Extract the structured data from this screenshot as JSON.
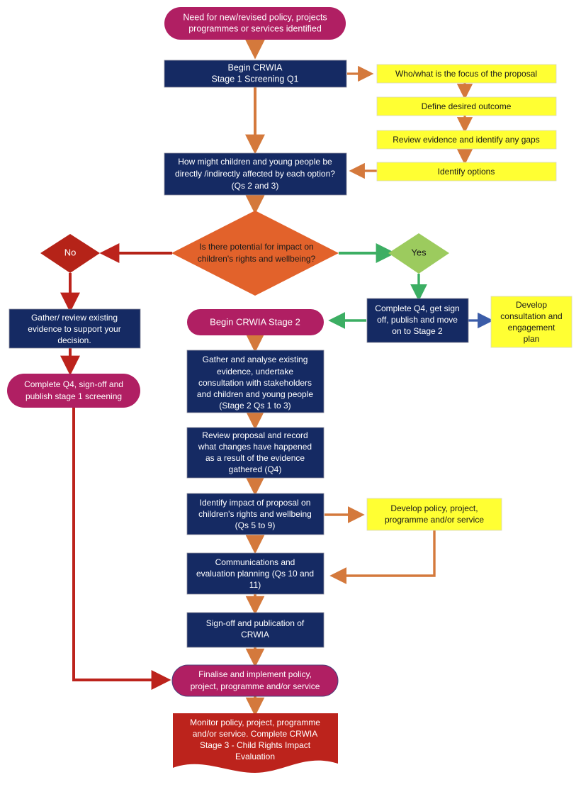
{
  "diagram": {
    "title": "CRWIA process flowchart",
    "palette": {
      "magenta": "#b01f63",
      "navy": "#152a63",
      "yellow": "#ffff33",
      "orange_fill": "#e2622b",
      "orange_arrow": "#d4793c",
      "dark_red": "#b52318",
      "red_fill": "#bc231c",
      "red_arrow": "#bc231c",
      "green_fill": "#9ccb5e",
      "green_arrow": "#3cae63",
      "blue_arrow": "#3b5ca8",
      "text_light": "#ffffff",
      "text_dark": "#1a1a1a"
    },
    "nodes": [
      {
        "id": "need",
        "shape": "rounded-pill",
        "color": "magenta",
        "lines": [
          "Need for  new/revised policy, projects",
          "programmes or services identified"
        ]
      },
      {
        "id": "begin-stage1",
        "shape": "rectangle",
        "color": "navy",
        "lines": [
          "Begin CRWIA",
          "Stage 1 Screening Q1"
        ]
      },
      {
        "id": "focus-of-proposal",
        "shape": "rectangle",
        "color": "yellow",
        "lines": [
          "Who/what is the focus of the proposal"
        ]
      },
      {
        "id": "define-outcome",
        "shape": "rectangle",
        "color": "yellow",
        "lines": [
          "Define desired outcome"
        ]
      },
      {
        "id": "review-evidence-gaps",
        "shape": "rectangle",
        "color": "yellow",
        "lines": [
          "Review evidence and identify any gaps"
        ]
      },
      {
        "id": "identify-options",
        "shape": "rectangle",
        "color": "yellow",
        "lines": [
          "Identify options"
        ]
      },
      {
        "id": "how-might-affected",
        "shape": "rectangle",
        "color": "navy",
        "lines": [
          "How might children and young people be",
          "directly /indirectly affected by each option?",
          "(Qs 2 and 3)"
        ]
      },
      {
        "id": "decision-potential-impact",
        "shape": "diamond",
        "color": "orange_fill",
        "lines": [
          "Is there potential for impact on",
          "children's rights and wellbeing?"
        ]
      },
      {
        "id": "decision-no",
        "shape": "diamond",
        "color": "dark_red",
        "lines": [
          "No"
        ]
      },
      {
        "id": "decision-yes",
        "shape": "diamond",
        "color": "green_fill",
        "lines": [
          "Yes"
        ]
      },
      {
        "id": "gather-review-existing",
        "shape": "rectangle",
        "color": "navy",
        "lines": [
          "Gather/ review existing",
          "evidence to support your",
          "decision."
        ]
      },
      {
        "id": "complete-q4-stage1",
        "shape": "rounded-pill",
        "color": "magenta",
        "lines": [
          "Complete Q4, sign-off and",
          "publish stage 1 screening"
        ]
      },
      {
        "id": "complete-q4-move-stage2",
        "shape": "rectangle",
        "color": "navy",
        "lines": [
          "Complete Q4, get sign",
          "off, publish and move",
          "on to Stage 2"
        ]
      },
      {
        "id": "develop-consultation-plan",
        "shape": "rectangle",
        "color": "yellow",
        "lines": [
          "Develop",
          "consultation and",
          "engagement",
          "plan"
        ]
      },
      {
        "id": "begin-stage2",
        "shape": "rounded-pill",
        "color": "magenta",
        "lines": [
          "Begin CRWIA Stage 2"
        ]
      },
      {
        "id": "gather-analyse",
        "shape": "rectangle",
        "color": "navy",
        "lines": [
          "Gather and analyse existing",
          "evidence, undertake",
          "consultation with stakeholders",
          "and children and young people",
          "(Stage 2 Qs 1 to 3)"
        ]
      },
      {
        "id": "review-proposal-record",
        "shape": "rectangle",
        "color": "navy",
        "lines": [
          "Review proposal and record",
          "what changes have happened",
          "as a result of the evidence",
          "gathered (Q4)"
        ]
      },
      {
        "id": "identify-impact",
        "shape": "rectangle",
        "color": "navy",
        "lines": [
          "Identify impact of proposal on",
          "children's rights and wellbeing",
          "(Qs 5 to 9)"
        ]
      },
      {
        "id": "develop-policy",
        "shape": "rectangle",
        "color": "yellow",
        "lines": [
          "Develop policy, project,",
          "programme and/or service"
        ]
      },
      {
        "id": "communications-evaluation",
        "shape": "rectangle",
        "color": "navy",
        "lines": [
          "Communications and",
          "evaluation planning (Qs 10 and",
          "11)"
        ]
      },
      {
        "id": "sign-off-publication",
        "shape": "rectangle",
        "color": "navy",
        "lines": [
          "Sign-off and publication of",
          "CRWIA"
        ]
      },
      {
        "id": "finalise-implement",
        "shape": "rounded-pill",
        "color": "magenta",
        "lines": [
          "Finalise and implement policy,",
          "project, programme and/or service"
        ]
      },
      {
        "id": "monitor-stage3",
        "shape": "wave-document",
        "color": "red_fill",
        "lines": [
          "Monitor policy, project, programme",
          "and/or service. Complete CRWIA",
          "Stage 3 - Child Rights Impact",
          "Evaluation"
        ]
      }
    ]
  }
}
